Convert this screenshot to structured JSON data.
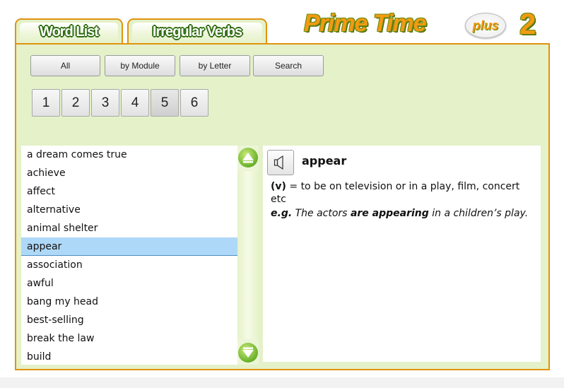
{
  "tabs": [
    {
      "label": "Word List"
    },
    {
      "label": "Irregular Verbs"
    }
  ],
  "logo": {
    "title": "Prime Time",
    "badge": "plus",
    "number": "2"
  },
  "filter_buttons": [
    {
      "label": "All"
    },
    {
      "label": "by Module"
    },
    {
      "label": "by Letter"
    },
    {
      "label": "Search"
    }
  ],
  "modules": [
    {
      "label": "1"
    },
    {
      "label": "2"
    },
    {
      "label": "3"
    },
    {
      "label": "4"
    },
    {
      "label": "5",
      "selected": true
    },
    {
      "label": "6"
    }
  ],
  "words": [
    "a dream comes true",
    "achieve",
    "affect",
    "alternative",
    "animal shelter",
    "appear",
    "association",
    "awful",
    "bang my head",
    "best-selling",
    "break the law",
    "build"
  ],
  "selected_word": "appear",
  "entry": {
    "headword": "appear",
    "pos": "(v)",
    "definition": " = to be on television or in a play, film, concert etc",
    "example_label": "e.g.",
    "example_before": " The actors ",
    "example_emphasis": "are appearing",
    "example_after": " in a children’s play."
  },
  "colors": {
    "panel_bg": "#e4f1c9",
    "border_orange": "#e1930f",
    "selected_row": "#aed8f7",
    "scroll_arrow_green": "#6ab12a",
    "logo_orange": "#f39a12"
  },
  "icons": [
    "speaker-icon",
    "scroll-up-icon",
    "scroll-down-icon"
  ]
}
